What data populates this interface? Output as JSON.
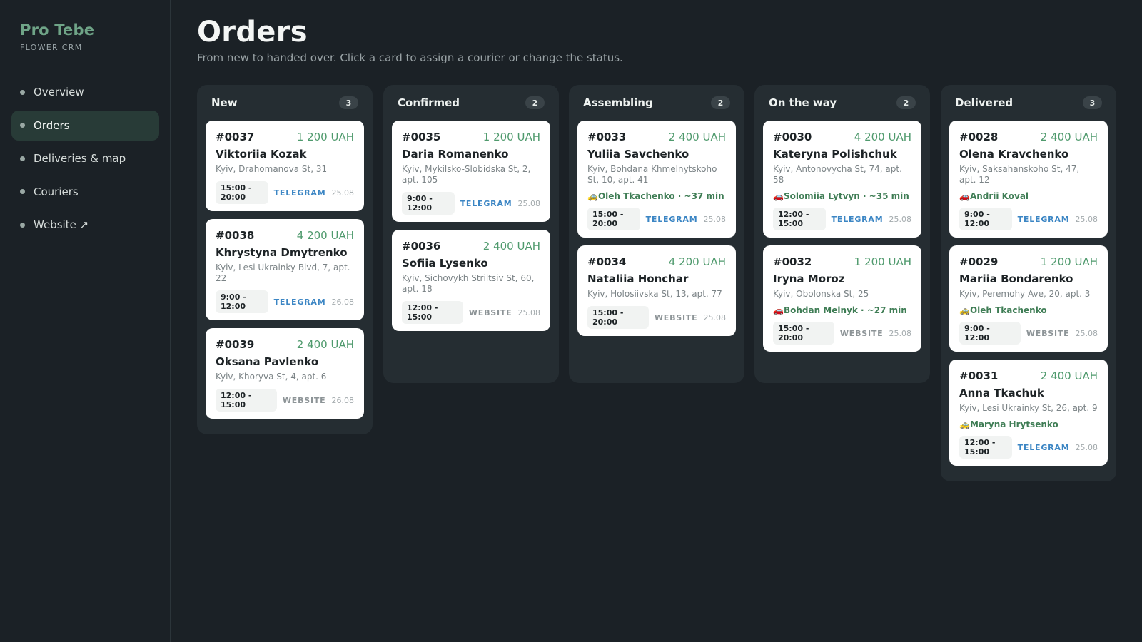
{
  "brand": {
    "name": "Pro Tebe",
    "subtitle": "FLOWER CRM"
  },
  "nav": [
    {
      "label": "Overview"
    },
    {
      "label": "Orders",
      "active": true
    },
    {
      "label": "Deliveries & map"
    },
    {
      "label": "Couriers"
    },
    {
      "label": "Website ↗"
    }
  ],
  "header": {
    "title": "Orders",
    "description": "From new to handed over. Click a card to assign a courier or change the status."
  },
  "colors": {
    "accent": "#4f9a6d",
    "telegram": "#3c86c4",
    "background": "#1b2126"
  },
  "columns": [
    {
      "title": "New",
      "count": "3",
      "cards": [
        {
          "id": "#0037",
          "price": "1 200 UAH",
          "name": "Viktoriia Kozak",
          "address": "Kyiv, Drahomanova St, 31",
          "courier": "",
          "slot": "15:00 - 20:00",
          "source": "TELEGRAM",
          "date": "25.08"
        },
        {
          "id": "#0038",
          "price": "4 200 UAH",
          "name": "Khrystyna Dmytrenko",
          "address": "Kyiv, Lesi Ukrainky Blvd, 7, apt. 22",
          "courier": "",
          "slot": "9:00 - 12:00",
          "source": "TELEGRAM",
          "date": "26.08"
        },
        {
          "id": "#0039",
          "price": "2 400 UAH",
          "name": "Oksana Pavlenko",
          "address": "Kyiv, Khoryva St, 4, apt. 6",
          "courier": "",
          "slot": "12:00 - 15:00",
          "source": "WEBSITE",
          "date": "26.08"
        }
      ]
    },
    {
      "title": "Confirmed",
      "count": "2",
      "cards": [
        {
          "id": "#0035",
          "price": "1 200 UAH",
          "name": "Daria Romanenko",
          "address": "Kyiv, Mykilsko-Slobidska St, 2, apt. 105",
          "courier": "",
          "slot": "9:00 - 12:00",
          "source": "TELEGRAM",
          "date": "25.08"
        },
        {
          "id": "#0036",
          "price": "2 400 UAH",
          "name": "Sofiia Lysenko",
          "address": "Kyiv, Sichovykh Striltsiv St, 60, apt. 18",
          "courier": "",
          "slot": "12:00 - 15:00",
          "source": "WEBSITE",
          "date": "25.08"
        }
      ]
    },
    {
      "title": "Assembling",
      "count": "2",
      "cards": [
        {
          "id": "#0033",
          "price": "2 400 UAH",
          "name": "Yuliia Savchenko",
          "address": "Kyiv, Bohdana Khmelnytskoho St, 10, apt. 41",
          "courier": "🚕Oleh Tkachenko · ~37 min",
          "slot": "15:00 - 20:00",
          "source": "TELEGRAM",
          "date": "25.08"
        },
        {
          "id": "#0034",
          "price": "4 200 UAH",
          "name": "Nataliia Honchar",
          "address": "Kyiv, Holosiivska St, 13, apt. 77",
          "courier": "",
          "slot": "15:00 - 20:00",
          "source": "WEBSITE",
          "date": "25.08"
        }
      ]
    },
    {
      "title": "On the way",
      "count": "2",
      "cards": [
        {
          "id": "#0030",
          "price": "4 200 UAH",
          "name": "Kateryna Polishchuk",
          "address": "Kyiv, Antonovycha St, 74, apt. 58",
          "courier": "🚗Solomiia Lytvyn · ~35 min",
          "slot": "12:00 - 15:00",
          "source": "TELEGRAM",
          "date": "25.08"
        },
        {
          "id": "#0032",
          "price": "1 200 UAH",
          "name": "Iryna Moroz",
          "address": "Kyiv, Obolonska St, 25",
          "courier": "🚗Bohdan Melnyk · ~27 min",
          "slot": "15:00 - 20:00",
          "source": "WEBSITE",
          "date": "25.08"
        }
      ]
    },
    {
      "title": "Delivered",
      "count": "3",
      "cards": [
        {
          "id": "#0028",
          "price": "2 400 UAH",
          "name": "Olena Kravchenko",
          "address": "Kyiv, Saksahanskoho St, 47, apt. 12",
          "courier": "🚗Andrii Koval",
          "slot": "9:00 - 12:00",
          "source": "TELEGRAM",
          "date": "25.08"
        },
        {
          "id": "#0029",
          "price": "1 200 UAH",
          "name": "Mariia Bondarenko",
          "address": "Kyiv, Peremohy Ave, 20, apt. 3",
          "courier": "🚕Oleh Tkachenko",
          "slot": "9:00 - 12:00",
          "source": "WEBSITE",
          "date": "25.08"
        },
        {
          "id": "#0031",
          "price": "2 400 UAH",
          "name": "Anna Tkachuk",
          "address": "Kyiv, Lesi Ukrainky St, 26, apt. 9",
          "courier": "🚕Maryna Hrytsenko",
          "slot": "12:00 - 15:00",
          "source": "TELEGRAM",
          "date": "25.08"
        }
      ]
    }
  ]
}
